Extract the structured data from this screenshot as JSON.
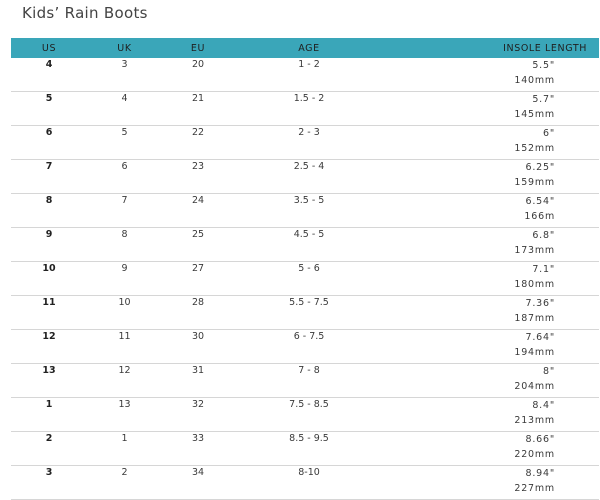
{
  "page": {
    "title": "Kids’ Rain Boots"
  },
  "table": {
    "headers": {
      "us": "US",
      "uk": "UK",
      "eu": "EU",
      "age": "AGE",
      "insole": "INSOLE LENGTH"
    },
    "rows": [
      {
        "us": "4",
        "uk": "3",
        "eu": "20",
        "age": "1 - 2",
        "inch": "5.5\"",
        "mm": "140mm"
      },
      {
        "us": "5",
        "uk": "4",
        "eu": "21",
        "age": "1.5 - 2",
        "inch": "5.7\"",
        "mm": "145mm"
      },
      {
        "us": "6",
        "uk": "5",
        "eu": "22",
        "age": "2 - 3",
        "inch": "6\"",
        "mm": "152mm"
      },
      {
        "us": "7",
        "uk": "6",
        "eu": "23",
        "age": "2.5 - 4",
        "inch": "6.25\"",
        "mm": "159mm"
      },
      {
        "us": "8",
        "uk": "7",
        "eu": "24",
        "age": "3.5 - 5",
        "inch": "6.54\"",
        "mm": "166m"
      },
      {
        "us": "9",
        "uk": "8",
        "eu": "25",
        "age": "4.5 - 5",
        "inch": "6.8\"",
        "mm": "173mm"
      },
      {
        "us": "10",
        "uk": "9",
        "eu": "27",
        "age": "5 - 6",
        "inch": "7.1\"",
        "mm": "180mm"
      },
      {
        "us": "11",
        "uk": "10",
        "eu": "28",
        "age": "5.5 - 7.5",
        "inch": "7.36\"",
        "mm": "187mm"
      },
      {
        "us": "12",
        "uk": "11",
        "eu": "30",
        "age": "6 - 7.5",
        "inch": "7.64\"",
        "mm": "194mm"
      },
      {
        "us": "13",
        "uk": "12",
        "eu": "31",
        "age": "7 - 8",
        "inch": "8\"",
        "mm": "204mm"
      },
      {
        "us": "1",
        "uk": "13",
        "eu": "32",
        "age": "7.5 - 8.5",
        "inch": "8.4\"",
        "mm": "213mm"
      },
      {
        "us": "2",
        "uk": "1",
        "eu": "33",
        "age": "8.5 - 9.5",
        "inch": "8.66\"",
        "mm": "220mm"
      },
      {
        "us": "3",
        "uk": "2",
        "eu": "34",
        "age": "8-10",
        "inch": "8.94\"",
        "mm": "227mm"
      }
    ]
  },
  "colors": {
    "header_background": "#3aa6b9",
    "row_divider": "#d6d6d6"
  }
}
